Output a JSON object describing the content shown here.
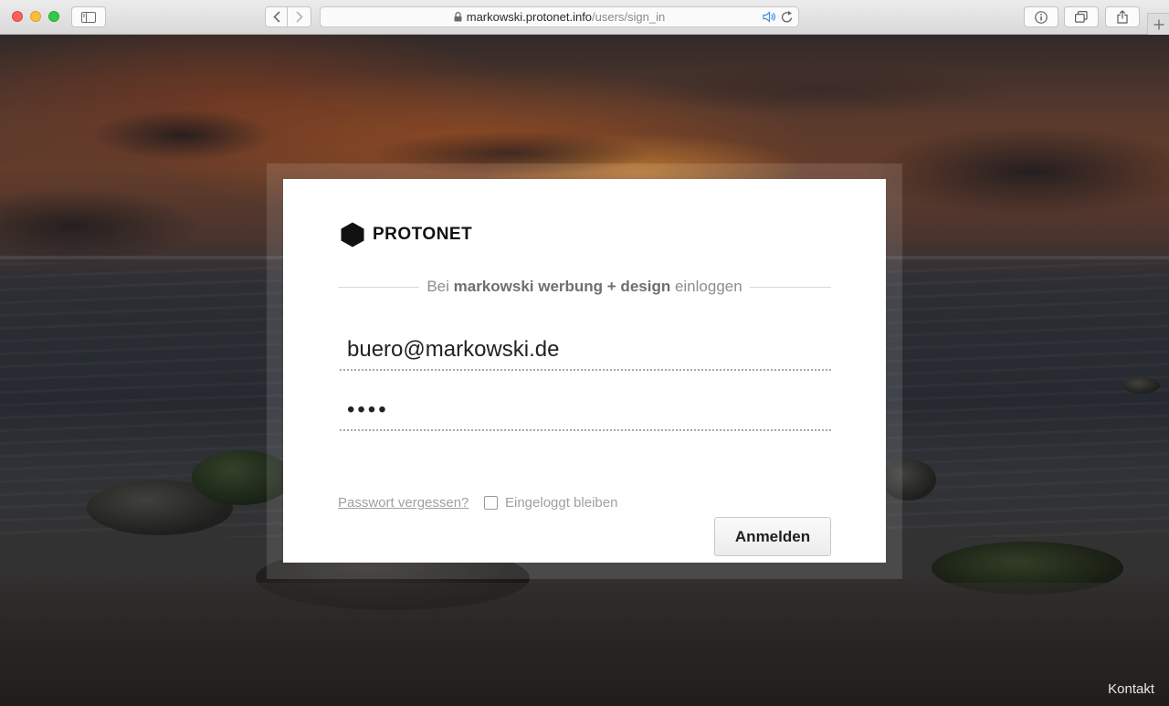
{
  "browser": {
    "url_host": "markowski.protonet.info",
    "url_path": "/users/sign_in",
    "icons": {
      "sidebar": "sidebar-icon",
      "back": "chevron-left-icon",
      "forward": "chevron-right-icon",
      "lock": "lock-icon",
      "audio": "speaker-icon",
      "reload": "reload-icon",
      "info": "info-icon",
      "tabs": "tabs-icon",
      "share": "share-icon",
      "new_tab": "plus-icon"
    }
  },
  "login": {
    "logo_text": "PROTONET",
    "heading_prefix": "Bei",
    "heading_org": "markowski werbung + design",
    "heading_suffix": "einloggen",
    "email_value": "buero@markowski.de",
    "password_mask": "••••",
    "forgot_label": "Passwort vergessen?",
    "remember_label": "Eingeloggt bleiben",
    "remember_checked": false,
    "submit_label": "Anmelden"
  },
  "footer": {
    "kontakt_label": "Kontakt"
  },
  "colors": {
    "card_bg": "#ffffff",
    "heading_text": "#8d8d8d",
    "link_text": "#a0a0a0",
    "traffic_close": "#fc605c",
    "traffic_min": "#fdbc40",
    "traffic_max": "#34c84a"
  }
}
